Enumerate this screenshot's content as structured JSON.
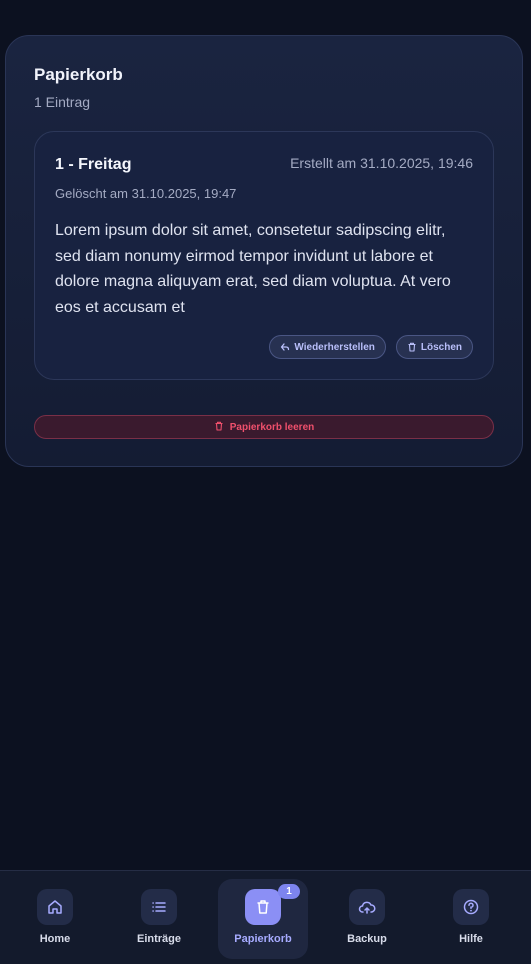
{
  "trash": {
    "title": "Papierkorb",
    "count_text": "1 Eintrag",
    "entries": [
      {
        "title": "1 - Freitag",
        "created": "Erstellt am 31.10.2025, 19:46",
        "deleted": "Gelöscht am 31.10.2025, 19:47",
        "text": "Lorem ipsum dolor sit amet, consetetur sadipscing elitr, sed diam nonumy eirmod tempor invidunt ut labore et dolore magna aliquyam erat, sed diam voluptua. At vero eos et accusam et",
        "restore_label": "Wiederherstellen",
        "delete_label": "Löschen"
      }
    ],
    "empty_label": "Papierkorb leeren"
  },
  "nav": {
    "items": [
      {
        "label": "Home",
        "icon": "home-icon"
      },
      {
        "label": "Einträge",
        "icon": "list-icon"
      },
      {
        "label": "Papierkorb",
        "icon": "trash-icon",
        "badge": "1",
        "active": true
      },
      {
        "label": "Backup",
        "icon": "cloud-upload-icon"
      },
      {
        "label": "Hilfe",
        "icon": "help-icon"
      }
    ]
  },
  "colors": {
    "background": "#0c1120",
    "accent": "#8b8ff5",
    "danger": "#f0506c"
  }
}
